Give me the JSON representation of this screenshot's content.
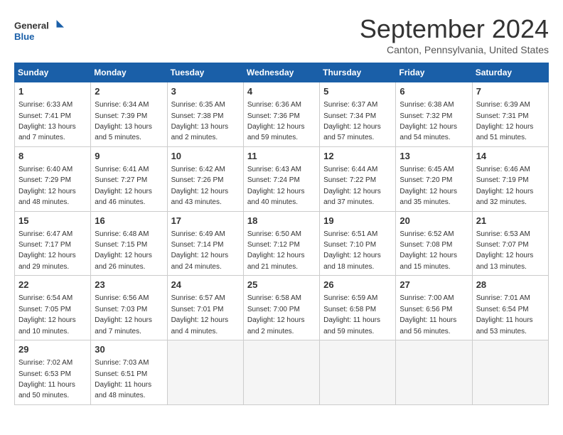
{
  "logo": {
    "text_general": "General",
    "text_blue": "Blue"
  },
  "title": "September 2024",
  "location": "Canton, Pennsylvania, United States",
  "days_of_week": [
    "Sunday",
    "Monday",
    "Tuesday",
    "Wednesday",
    "Thursday",
    "Friday",
    "Saturday"
  ],
  "weeks": [
    [
      {
        "day": "1",
        "sunrise": "6:33 AM",
        "sunset": "7:41 PM",
        "daylight": "13 hours and 7 minutes."
      },
      {
        "day": "2",
        "sunrise": "6:34 AM",
        "sunset": "7:39 PM",
        "daylight": "13 hours and 5 minutes."
      },
      {
        "day": "3",
        "sunrise": "6:35 AM",
        "sunset": "7:38 PM",
        "daylight": "13 hours and 2 minutes."
      },
      {
        "day": "4",
        "sunrise": "6:36 AM",
        "sunset": "7:36 PM",
        "daylight": "12 hours and 59 minutes."
      },
      {
        "day": "5",
        "sunrise": "6:37 AM",
        "sunset": "7:34 PM",
        "daylight": "12 hours and 57 minutes."
      },
      {
        "day": "6",
        "sunrise": "6:38 AM",
        "sunset": "7:32 PM",
        "daylight": "12 hours and 54 minutes."
      },
      {
        "day": "7",
        "sunrise": "6:39 AM",
        "sunset": "7:31 PM",
        "daylight": "12 hours and 51 minutes."
      }
    ],
    [
      {
        "day": "8",
        "sunrise": "6:40 AM",
        "sunset": "7:29 PM",
        "daylight": "12 hours and 48 minutes."
      },
      {
        "day": "9",
        "sunrise": "6:41 AM",
        "sunset": "7:27 PM",
        "daylight": "12 hours and 46 minutes."
      },
      {
        "day": "10",
        "sunrise": "6:42 AM",
        "sunset": "7:26 PM",
        "daylight": "12 hours and 43 minutes."
      },
      {
        "day": "11",
        "sunrise": "6:43 AM",
        "sunset": "7:24 PM",
        "daylight": "12 hours and 40 minutes."
      },
      {
        "day": "12",
        "sunrise": "6:44 AM",
        "sunset": "7:22 PM",
        "daylight": "12 hours and 37 minutes."
      },
      {
        "day": "13",
        "sunrise": "6:45 AM",
        "sunset": "7:20 PM",
        "daylight": "12 hours and 35 minutes."
      },
      {
        "day": "14",
        "sunrise": "6:46 AM",
        "sunset": "7:19 PM",
        "daylight": "12 hours and 32 minutes."
      }
    ],
    [
      {
        "day": "15",
        "sunrise": "6:47 AM",
        "sunset": "7:17 PM",
        "daylight": "12 hours and 29 minutes."
      },
      {
        "day": "16",
        "sunrise": "6:48 AM",
        "sunset": "7:15 PM",
        "daylight": "12 hours and 26 minutes."
      },
      {
        "day": "17",
        "sunrise": "6:49 AM",
        "sunset": "7:14 PM",
        "daylight": "12 hours and 24 minutes."
      },
      {
        "day": "18",
        "sunrise": "6:50 AM",
        "sunset": "7:12 PM",
        "daylight": "12 hours and 21 minutes."
      },
      {
        "day": "19",
        "sunrise": "6:51 AM",
        "sunset": "7:10 PM",
        "daylight": "12 hours and 18 minutes."
      },
      {
        "day": "20",
        "sunrise": "6:52 AM",
        "sunset": "7:08 PM",
        "daylight": "12 hours and 15 minutes."
      },
      {
        "day": "21",
        "sunrise": "6:53 AM",
        "sunset": "7:07 PM",
        "daylight": "12 hours and 13 minutes."
      }
    ],
    [
      {
        "day": "22",
        "sunrise": "6:54 AM",
        "sunset": "7:05 PM",
        "daylight": "12 hours and 10 minutes."
      },
      {
        "day": "23",
        "sunrise": "6:56 AM",
        "sunset": "7:03 PM",
        "daylight": "12 hours and 7 minutes."
      },
      {
        "day": "24",
        "sunrise": "6:57 AM",
        "sunset": "7:01 PM",
        "daylight": "12 hours and 4 minutes."
      },
      {
        "day": "25",
        "sunrise": "6:58 AM",
        "sunset": "7:00 PM",
        "daylight": "12 hours and 2 minutes."
      },
      {
        "day": "26",
        "sunrise": "6:59 AM",
        "sunset": "6:58 PM",
        "daylight": "11 hours and 59 minutes."
      },
      {
        "day": "27",
        "sunrise": "7:00 AM",
        "sunset": "6:56 PM",
        "daylight": "11 hours and 56 minutes."
      },
      {
        "day": "28",
        "sunrise": "7:01 AM",
        "sunset": "6:54 PM",
        "daylight": "11 hours and 53 minutes."
      }
    ],
    [
      {
        "day": "29",
        "sunrise": "7:02 AM",
        "sunset": "6:53 PM",
        "daylight": "11 hours and 50 minutes."
      },
      {
        "day": "30",
        "sunrise": "7:03 AM",
        "sunset": "6:51 PM",
        "daylight": "11 hours and 48 minutes."
      },
      null,
      null,
      null,
      null,
      null
    ]
  ],
  "labels": {
    "sunrise": "Sunrise:",
    "sunset": "Sunset:",
    "daylight": "Daylight:"
  }
}
